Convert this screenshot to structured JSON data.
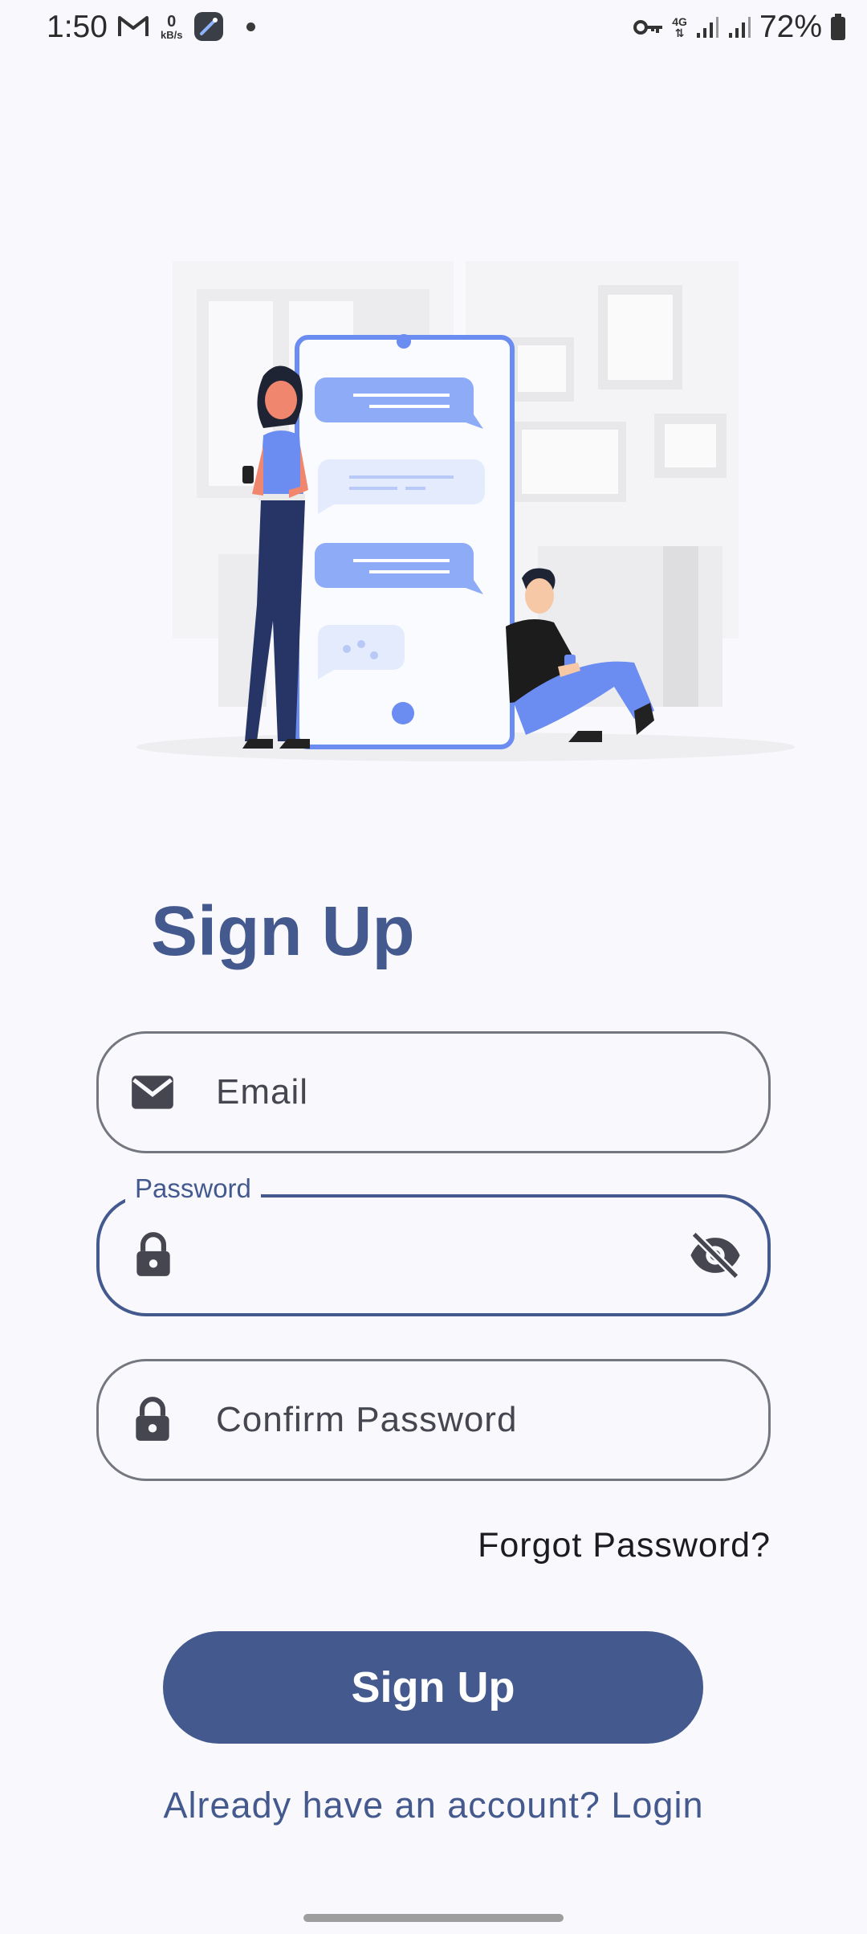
{
  "status_bar": {
    "time": "1:50",
    "net_speed_value": "0",
    "net_speed_unit": "kB/s",
    "network_type": "4G",
    "battery_percent": "72%"
  },
  "page": {
    "title": "Sign Up"
  },
  "form": {
    "email_placeholder": "Email",
    "password_label": "Password",
    "confirm_placeholder": "Confirm Password",
    "forgot_password": "Forgot Password?",
    "submit_label": "Sign Up",
    "login_prompt": "Already have an account? Login"
  },
  "colors": {
    "accent": "#44598e",
    "background": "#f9f9fd",
    "illustration_blue": "#6b8cf0"
  }
}
